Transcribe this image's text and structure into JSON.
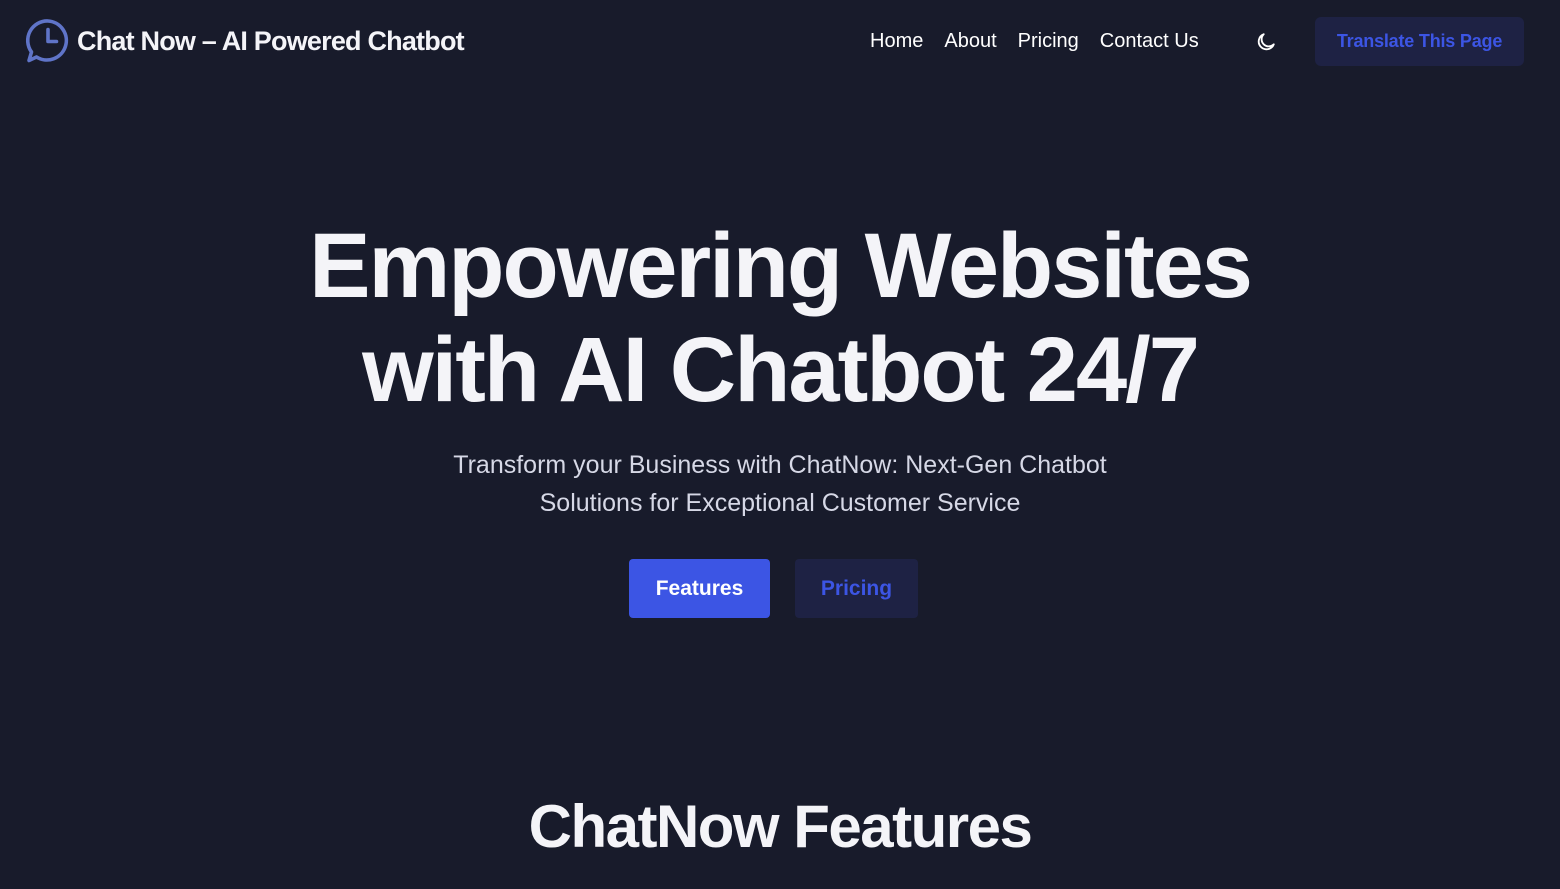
{
  "brand": {
    "logo_icon": "chat-clock-icon",
    "title": "Chat Now – AI Powered Chatbot"
  },
  "nav": {
    "items": [
      {
        "label": "Home"
      },
      {
        "label": "About"
      },
      {
        "label": "Pricing"
      },
      {
        "label": "Contact Us"
      }
    ],
    "theme_toggle_icon": "moon-icon",
    "translate_label": "Translate This Page"
  },
  "hero": {
    "title_line1": "Empowering Websites",
    "title_line2": "with AI Chatbot 24/7",
    "subtitle_line1": "Transform your Business with ChatNow: Next-Gen Chatbot",
    "subtitle_line2": "Solutions for Exceptional Customer Service",
    "primary_cta": "Features",
    "secondary_cta": "Pricing"
  },
  "features_section": {
    "title": "ChatNow Features"
  },
  "colors": {
    "background": "#181b2b",
    "accent": "#3c55e4",
    "button_dark": "#1e2244",
    "logo": "#5f74c8",
    "text": "#f4f4f8"
  }
}
